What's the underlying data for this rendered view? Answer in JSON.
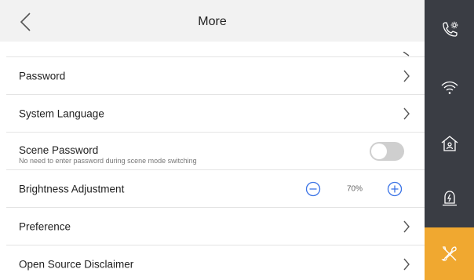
{
  "header": {
    "title": "More"
  },
  "settings": {
    "password": "Password",
    "system_language": "System Language",
    "scene_password": {
      "title": "Scene Password",
      "subtitle": "No need to enter password during scene mode switching",
      "enabled": false
    },
    "brightness": {
      "label": "Brightness Adjustment",
      "value": "70%"
    },
    "preference": "Preference",
    "open_source": "Open Source Disclaimer"
  },
  "sidebar": {
    "items": [
      {
        "icon": "phone-settings-icon",
        "active": false
      },
      {
        "icon": "wifi-icon",
        "active": false
      },
      {
        "icon": "home-icon",
        "active": false
      },
      {
        "icon": "alarm-icon",
        "active": false
      },
      {
        "icon": "tools-icon",
        "active": true
      }
    ]
  },
  "colors": {
    "sidebar_bg": "#3a3d44",
    "active_tab": "#f0a830",
    "accent_blue": "#3b73e6",
    "toggle_off": "#cfcfcf"
  }
}
